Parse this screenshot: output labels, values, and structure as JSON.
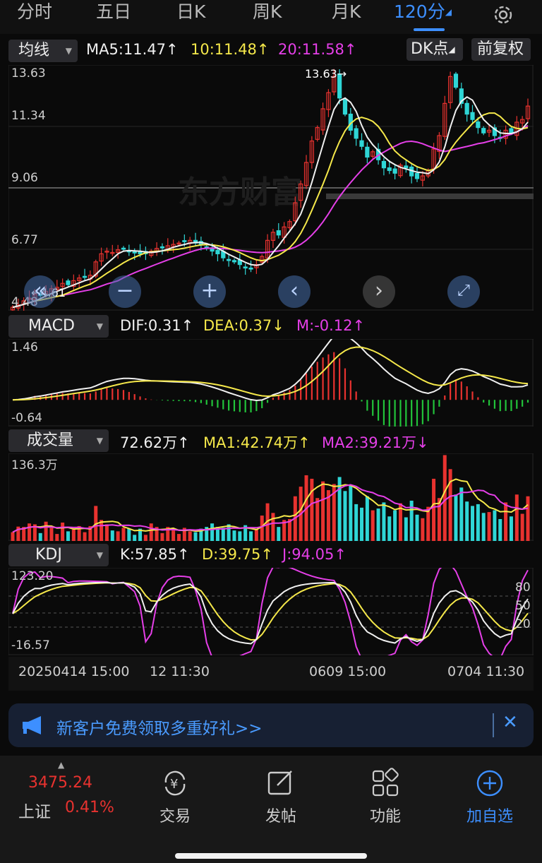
{
  "tabs": [
    {
      "label": "分时"
    },
    {
      "label": "五日"
    },
    {
      "label": "日K"
    },
    {
      "label": "周K"
    },
    {
      "label": "月K"
    },
    {
      "label": "120分"
    }
  ],
  "active_tab": "120分",
  "main": {
    "indicator_select": "均线",
    "ma5": "MA5:11.47",
    "ma10": "10:11.48",
    "ma20": "20:11.58",
    "dk_button": "DK点",
    "adjust_button": "前复权",
    "y_labels": [
      "13.63",
      "11.34",
      "9.06",
      "6.77",
      "4.48"
    ],
    "high_marker": "13.63→",
    "low_marker": "←4.61",
    "watermark": "东方财富"
  },
  "macd": {
    "select": "MACD",
    "dif": "DIF:0.31",
    "dea": "DEA:0.37",
    "m": "M:-0.12",
    "y_max": "1.46",
    "y_min": "-0.64"
  },
  "volume": {
    "select": "成交量",
    "vol": "72.62万",
    "ma1": "MA1:42.74万",
    "ma2": "MA2:39.21万",
    "y_max": "136.3万"
  },
  "kdj": {
    "select": "KDJ",
    "k": "K:57.85",
    "d": "D:39.75",
    "j": "J:94.05",
    "y_max": "123.20",
    "y_min": "-16.57",
    "right_levels": [
      "80",
      "50",
      "20"
    ]
  },
  "x_labels": [
    "20250414 15:00",
    "12 11:30",
    "0609 15:00",
    "0704 11:30"
  ],
  "banner": {
    "text": "新客户免费领取多重好礼>>"
  },
  "index": {
    "value": "3475.24",
    "name": "上证",
    "change": "0.41%"
  },
  "bottom_nav": [
    {
      "label": "交易",
      "icon": "trade-yen-icon"
    },
    {
      "label": "发帖",
      "icon": "edit-post-icon"
    },
    {
      "label": "功能",
      "icon": "grid-apps-icon"
    },
    {
      "label": "加自选",
      "icon": "add-circle-icon"
    }
  ],
  "colors": {
    "up": "#e8322f",
    "down": "#2fd6d6",
    "accent": "#3d8fff",
    "ma5": "#f0f0f0",
    "ma10": "#f5e84a",
    "ma20": "#e53fe8"
  },
  "chart_data": {
    "type": "candlestick",
    "ylim": [
      4.48,
      13.63
    ],
    "closes": [
      4.61,
      4.7,
      4.85,
      4.95,
      5.1,
      5.05,
      5.2,
      5.3,
      5.35,
      5.5,
      5.45,
      5.6,
      5.7,
      5.75,
      5.8,
      6.3,
      6.6,
      6.7,
      6.65,
      6.75,
      6.8,
      6.7,
      6.65,
      6.6,
      6.6,
      6.7,
      6.8,
      6.85,
      6.9,
      6.95,
      7.0,
      7.05,
      7.1,
      7.0,
      6.95,
      6.8,
      6.7,
      6.6,
      6.45,
      6.35,
      6.3,
      6.2,
      6.1,
      6.05,
      6.2,
      6.5,
      7.1,
      7.4,
      7.3,
      7.6,
      7.8,
      8.5,
      9.2,
      10.0,
      10.8,
      11.3,
      12.0,
      12.6,
      13.2,
      12.4,
      11.8,
      11.2,
      10.9,
      10.6,
      10.2,
      10.4,
      10.1,
      9.8,
      9.7,
      9.6,
      9.9,
      9.8,
      9.5,
      9.4,
      9.5,
      9.7,
      10.5,
      11.0,
      12.2,
      13.2,
      12.8,
      12.2,
      11.8,
      11.6,
      11.3,
      11.1,
      11.2,
      11.0,
      10.9,
      11.2,
      11.1,
      11.5,
      11.6,
      12.1
    ]
  }
}
